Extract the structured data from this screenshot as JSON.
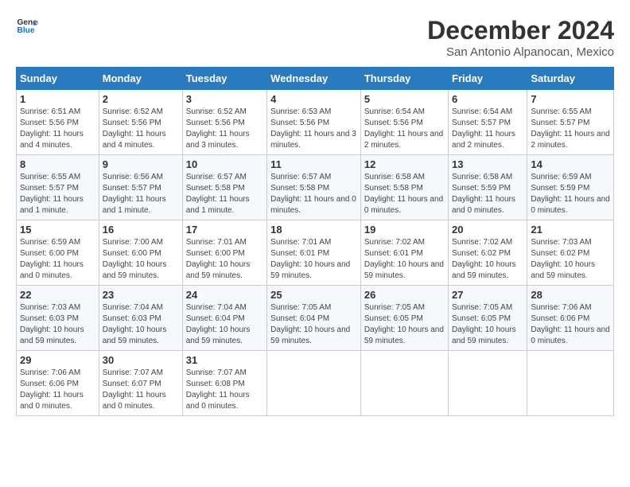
{
  "header": {
    "logo_line1": "General",
    "logo_line2": "Blue",
    "title": "December 2024",
    "subtitle": "San Antonio Alpanocan, Mexico"
  },
  "columns": [
    "Sunday",
    "Monday",
    "Tuesday",
    "Wednesday",
    "Thursday",
    "Friday",
    "Saturday"
  ],
  "weeks": [
    [
      {
        "day": "1",
        "info": "Sunrise: 6:51 AM\nSunset: 5:56 PM\nDaylight: 11 hours and 4 minutes."
      },
      {
        "day": "2",
        "info": "Sunrise: 6:52 AM\nSunset: 5:56 PM\nDaylight: 11 hours and 4 minutes."
      },
      {
        "day": "3",
        "info": "Sunrise: 6:52 AM\nSunset: 5:56 PM\nDaylight: 11 hours and 3 minutes."
      },
      {
        "day": "4",
        "info": "Sunrise: 6:53 AM\nSunset: 5:56 PM\nDaylight: 11 hours and 3 minutes."
      },
      {
        "day": "5",
        "info": "Sunrise: 6:54 AM\nSunset: 5:56 PM\nDaylight: 11 hours and 2 minutes."
      },
      {
        "day": "6",
        "info": "Sunrise: 6:54 AM\nSunset: 5:57 PM\nDaylight: 11 hours and 2 minutes."
      },
      {
        "day": "7",
        "info": "Sunrise: 6:55 AM\nSunset: 5:57 PM\nDaylight: 11 hours and 2 minutes."
      }
    ],
    [
      {
        "day": "8",
        "info": "Sunrise: 6:55 AM\nSunset: 5:57 PM\nDaylight: 11 hours and 1 minute."
      },
      {
        "day": "9",
        "info": "Sunrise: 6:56 AM\nSunset: 5:57 PM\nDaylight: 11 hours and 1 minute."
      },
      {
        "day": "10",
        "info": "Sunrise: 6:57 AM\nSunset: 5:58 PM\nDaylight: 11 hours and 1 minute."
      },
      {
        "day": "11",
        "info": "Sunrise: 6:57 AM\nSunset: 5:58 PM\nDaylight: 11 hours and 0 minutes."
      },
      {
        "day": "12",
        "info": "Sunrise: 6:58 AM\nSunset: 5:58 PM\nDaylight: 11 hours and 0 minutes."
      },
      {
        "day": "13",
        "info": "Sunrise: 6:58 AM\nSunset: 5:59 PM\nDaylight: 11 hours and 0 minutes."
      },
      {
        "day": "14",
        "info": "Sunrise: 6:59 AM\nSunset: 5:59 PM\nDaylight: 11 hours and 0 minutes."
      }
    ],
    [
      {
        "day": "15",
        "info": "Sunrise: 6:59 AM\nSunset: 6:00 PM\nDaylight: 11 hours and 0 minutes."
      },
      {
        "day": "16",
        "info": "Sunrise: 7:00 AM\nSunset: 6:00 PM\nDaylight: 10 hours and 59 minutes."
      },
      {
        "day": "17",
        "info": "Sunrise: 7:01 AM\nSunset: 6:00 PM\nDaylight: 10 hours and 59 minutes."
      },
      {
        "day": "18",
        "info": "Sunrise: 7:01 AM\nSunset: 6:01 PM\nDaylight: 10 hours and 59 minutes."
      },
      {
        "day": "19",
        "info": "Sunrise: 7:02 AM\nSunset: 6:01 PM\nDaylight: 10 hours and 59 minutes."
      },
      {
        "day": "20",
        "info": "Sunrise: 7:02 AM\nSunset: 6:02 PM\nDaylight: 10 hours and 59 minutes."
      },
      {
        "day": "21",
        "info": "Sunrise: 7:03 AM\nSunset: 6:02 PM\nDaylight: 10 hours and 59 minutes."
      }
    ],
    [
      {
        "day": "22",
        "info": "Sunrise: 7:03 AM\nSunset: 6:03 PM\nDaylight: 10 hours and 59 minutes."
      },
      {
        "day": "23",
        "info": "Sunrise: 7:04 AM\nSunset: 6:03 PM\nDaylight: 10 hours and 59 minutes."
      },
      {
        "day": "24",
        "info": "Sunrise: 7:04 AM\nSunset: 6:04 PM\nDaylight: 10 hours and 59 minutes."
      },
      {
        "day": "25",
        "info": "Sunrise: 7:05 AM\nSunset: 6:04 PM\nDaylight: 10 hours and 59 minutes."
      },
      {
        "day": "26",
        "info": "Sunrise: 7:05 AM\nSunset: 6:05 PM\nDaylight: 10 hours and 59 minutes."
      },
      {
        "day": "27",
        "info": "Sunrise: 7:05 AM\nSunset: 6:05 PM\nDaylight: 10 hours and 59 minutes."
      },
      {
        "day": "28",
        "info": "Sunrise: 7:06 AM\nSunset: 6:06 PM\nDaylight: 11 hours and 0 minutes."
      }
    ],
    [
      {
        "day": "29",
        "info": "Sunrise: 7:06 AM\nSunset: 6:06 PM\nDaylight: 11 hours and 0 minutes."
      },
      {
        "day": "30",
        "info": "Sunrise: 7:07 AM\nSunset: 6:07 PM\nDaylight: 11 hours and 0 minutes."
      },
      {
        "day": "31",
        "info": "Sunrise: 7:07 AM\nSunset: 6:08 PM\nDaylight: 11 hours and 0 minutes."
      },
      null,
      null,
      null,
      null
    ]
  ]
}
